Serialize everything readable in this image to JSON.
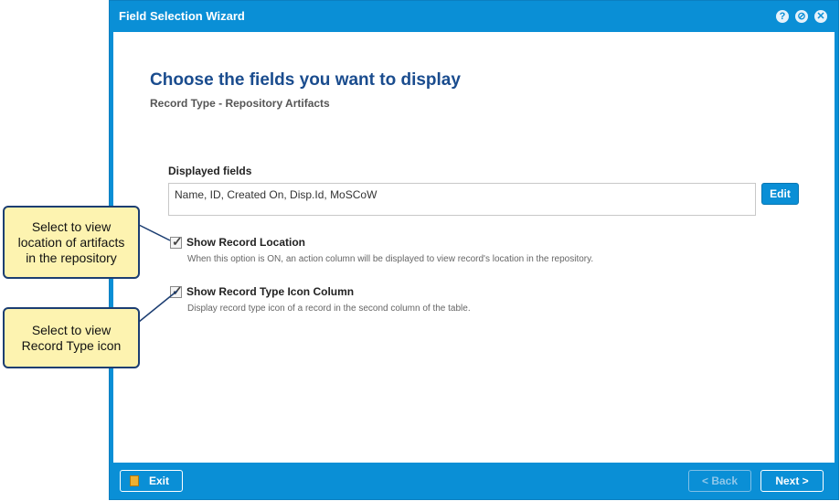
{
  "window": {
    "title": "Field Selection Wizard",
    "help_glyph": "?",
    "minimize_glyph": "⊘",
    "close_glyph": "✕"
  },
  "main": {
    "heading": "Choose the fields you want to display",
    "subheading": "Record Type - Repository Artifacts",
    "displayed_fields_label": "Displayed fields",
    "displayed_fields_value": "Name, ID, Created On, Disp.Id, MoSCoW",
    "edit_label": "Edit",
    "options": [
      {
        "label": "Show Record Location",
        "description": "When this option is ON, an action column will be displayed to view record's location in the repository.",
        "checked": true
      },
      {
        "label": "Show Record Type Icon Column",
        "description": "Display record type icon of a record in the second column of the table.",
        "checked": true
      }
    ]
  },
  "footer": {
    "exit_label": "Exit",
    "back_label": "< Back",
    "next_label": "Next >"
  },
  "callouts": {
    "location_lines": [
      "Select to view",
      "location of artifacts",
      "in the repository"
    ],
    "icon_lines": [
      "Select to view",
      "Record Type icon"
    ]
  },
  "colors": {
    "accent": "#0a8fd6",
    "heading": "#1a4c8e",
    "callout_fill": "#fdf3b0",
    "callout_border": "#1c3e72"
  }
}
